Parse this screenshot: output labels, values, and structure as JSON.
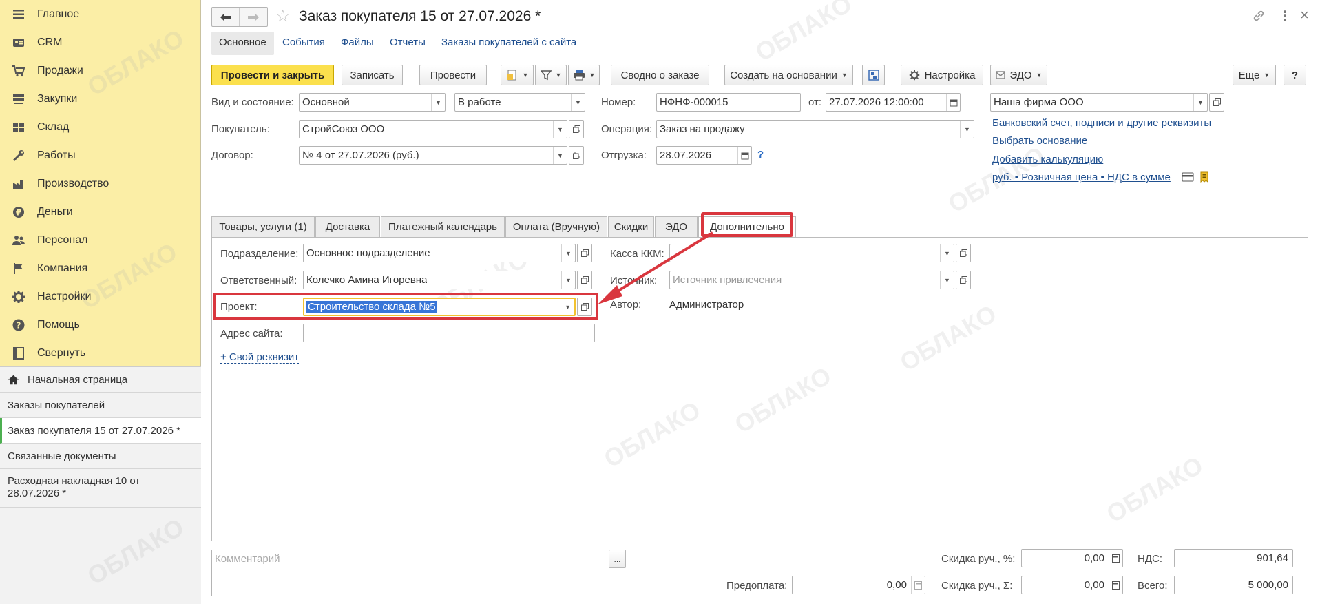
{
  "sidebar": {
    "sections": [
      {
        "label": "Главное",
        "icon": "menu-icon"
      },
      {
        "label": "CRM",
        "icon": "crm-icon"
      },
      {
        "label": "Продажи",
        "icon": "cart-icon"
      },
      {
        "label": "Закупки",
        "icon": "purchases-icon"
      },
      {
        "label": "Склад",
        "icon": "warehouse-icon"
      },
      {
        "label": "Работы",
        "icon": "tools-icon"
      },
      {
        "label": "Производство",
        "icon": "factory-icon"
      },
      {
        "label": "Деньги",
        "icon": "money-icon"
      },
      {
        "label": "Персонал",
        "icon": "people-icon"
      },
      {
        "label": "Компания",
        "icon": "flag-icon"
      },
      {
        "label": "Настройки",
        "icon": "gear-icon"
      },
      {
        "label": "Помощь",
        "icon": "help-icon"
      },
      {
        "label": "Свернуть",
        "icon": "collapse-icon"
      }
    ],
    "home": "Начальная страница",
    "open_windows": [
      "Заказы покупателей",
      "Заказ покупателя 15 от 27.07.2026 *",
      "Связанные документы",
      "Расходная накладная 10 от 28.07.2026 *"
    ]
  },
  "header": {
    "title": "Заказ покупателя 15 от 27.07.2026 *"
  },
  "nav_tabs": [
    "Основное",
    "События",
    "Файлы",
    "Отчеты",
    "Заказы покупателей с сайта"
  ],
  "toolbar": {
    "post_close": "Провести и закрыть",
    "save": "Записать",
    "post": "Провести",
    "summary": "Сводно о заказе",
    "create_based": "Создать на основании",
    "settings": "Настройка",
    "edo": "ЭДО",
    "more": "Еще"
  },
  "form": {
    "status_label": "Вид и состояние:",
    "kind": "Основной",
    "state": "В работе",
    "number_label": "Номер:",
    "number": "НФНФ-000015",
    "date_label": "от:",
    "date": "27.07.2026 12:00:00",
    "company": "Наша фирма ООО",
    "buyer_label": "Покупатель:",
    "buyer": "СтройСоюз ООО",
    "operation_label": "Операция:",
    "operation": "Заказ на продажу",
    "contract_label": "Договор:",
    "contract": "№ 4 от 27.07.2026 (руб.)",
    "shipment_label": "Отгрузка:",
    "shipment": "28.07.2026",
    "help": "?"
  },
  "links": {
    "bank": "Банковский счет, подписи и другие реквизиты",
    "basis": "Выбрать основание",
    "calc": "Добавить калькуляцию",
    "price": "руб. • Розничная цена • НДС в сумме"
  },
  "tabs": [
    "Товары, услуги (1)",
    "Доставка",
    "Платежный календарь",
    "Оплата (Вручную)",
    "Скидки",
    "ЭДО",
    "Дополнительно"
  ],
  "extra": {
    "division_label": "Подразделение:",
    "division": "Основное подразделение",
    "responsible_label": "Ответственный:",
    "responsible": "Колечко Амина Игоревна",
    "project_label": "Проект:",
    "project": "Строительство склада №5",
    "site_label": "Адрес сайта:",
    "site": "",
    "custom_attr": "+ Свой реквизит",
    "cash_label": "Касса ККМ:",
    "cash": "",
    "source_label": "Источник:",
    "source_placeholder": "Источник привлечения",
    "author_label": "Автор:",
    "author": "Администратор"
  },
  "footer": {
    "comment_placeholder": "Комментарий",
    "ellipsis": "...",
    "prepay_label": "Предоплата:",
    "prepay": "0,00",
    "discount_pct_label": "Скидка руч., %:",
    "discount_pct": "0,00",
    "discount_sum_label": "Скидка руч., Σ:",
    "discount_sum": "0,00",
    "vat_label": "НДС:",
    "vat": "901,64",
    "total_label": "Всего:",
    "total": "5 000,00"
  },
  "watermark": "ОБЛАКО",
  "colors": {
    "sidebar_bg": "#fbeea6",
    "primary_button": "#fbe04d",
    "link": "#1f4f8f",
    "highlight_frame": "#d9363e",
    "selection": "#3875d7"
  }
}
